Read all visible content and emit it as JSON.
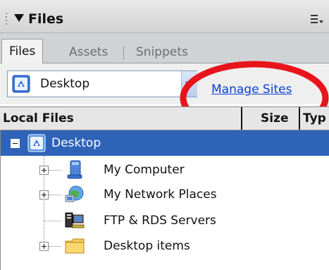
{
  "panel": {
    "title": "Files"
  },
  "tabs": [
    {
      "label": "Files",
      "active": true
    },
    {
      "label": "Assets",
      "active": false
    },
    {
      "label": "Snippets",
      "active": false
    }
  ],
  "site_select": {
    "value": "Desktop",
    "icon": "site-icon"
  },
  "manage_sites": {
    "label": "Manage Sites"
  },
  "columns": {
    "local": "Local Files",
    "size": "Size",
    "type": "Typ"
  },
  "tree": {
    "root": {
      "label": "Desktop",
      "expanded": true,
      "selected": true
    },
    "items": [
      {
        "label": "My Computer",
        "icon": "computer-icon",
        "expandable": true
      },
      {
        "label": "My Network Places",
        "icon": "network-places-icon",
        "expandable": true
      },
      {
        "label": "FTP & RDS Servers",
        "icon": "ftp-servers-icon",
        "expandable": false
      },
      {
        "label": "Desktop items",
        "icon": "folder-icon",
        "expandable": true
      }
    ]
  },
  "colors": {
    "selection": "#2f63b8",
    "link": "#0b3ecf",
    "highlight": "#e8141c"
  }
}
